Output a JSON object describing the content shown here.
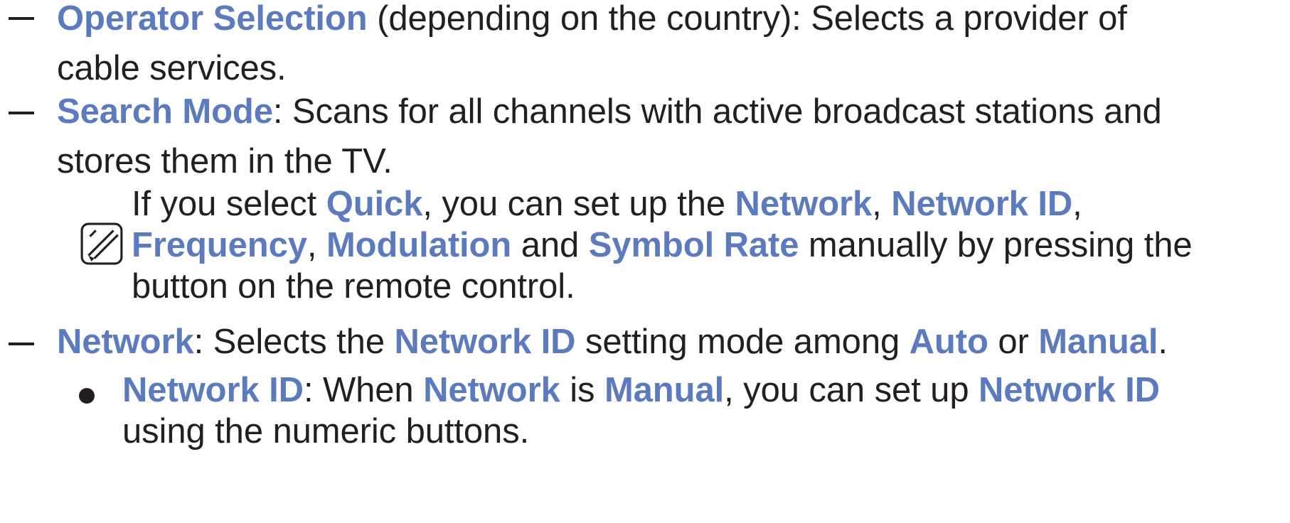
{
  "items": {
    "operator": {
      "term": "Operator Selection",
      "text_a": " (depending on the country): Selects a provider of",
      "text_b": "cable services."
    },
    "search": {
      "term": "Search Mode",
      "text_a": ": Scans for all channels with active broadcast stations and",
      "text_b": "stores them in the TV."
    },
    "note": {
      "icon": "note-pencil-icon",
      "t1": "If you select ",
      "b1": "Quick",
      "t2": ", you can set up the ",
      "b2": "Network",
      "t3": ", ",
      "b3": "Network ID",
      "t4": ",",
      "b4": "Frequency",
      "t5": ", ",
      "b5": "Modulation",
      "t6": " and ",
      "b6": "Symbol Rate",
      "t7": " manually by pressing the",
      "t8": "button on the remote control."
    },
    "network": {
      "term": "Network",
      "t1": ": Selects the ",
      "b1": "Network ID",
      "t2": " setting mode among ",
      "b2": "Auto",
      "t3": " or ",
      "b3": "Manual",
      "t4": "."
    },
    "network_id": {
      "term": "Network ID",
      "t1": ": When ",
      "b1": "Network",
      "t2": " is ",
      "b2": "Manual",
      "t3": ", you can set up ",
      "b3": "Network ID",
      "t4": "using the numeric buttons."
    }
  },
  "colors": {
    "highlight": "#5b7bbe",
    "text": "#231f20"
  }
}
